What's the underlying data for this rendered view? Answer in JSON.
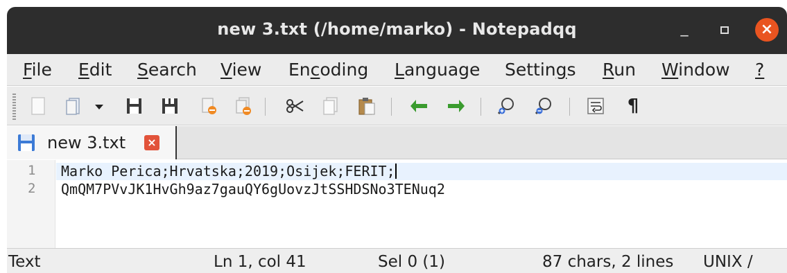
{
  "window": {
    "title": "new 3.txt (/home/marko) - Notepadqq",
    "minimize_glyph": "_",
    "close_glyph": "×"
  },
  "menu": {
    "items": [
      {
        "pre": "",
        "mnemonic": "F",
        "post": "ile"
      },
      {
        "pre": "",
        "mnemonic": "E",
        "post": "dit"
      },
      {
        "pre": "",
        "mnemonic": "S",
        "post": "earch"
      },
      {
        "pre": "",
        "mnemonic": "V",
        "post": "iew"
      },
      {
        "pre": "En",
        "mnemonic": "c",
        "post": "oding"
      },
      {
        "pre": "",
        "mnemonic": "L",
        "post": "anguage"
      },
      {
        "pre": "Settin",
        "mnemonic": "g",
        "post": "s"
      },
      {
        "pre": "",
        "mnemonic": "R",
        "post": "un"
      },
      {
        "pre": "",
        "mnemonic": "W",
        "post": "indow"
      },
      {
        "pre": "",
        "mnemonic": "?",
        "post": ""
      }
    ]
  },
  "toolbar": {
    "icons": [
      "new-file-icon",
      "open-file-icon",
      "open-dropdown-icon",
      "save-icon",
      "save-all-icon",
      "close-icon",
      "close-all-icon",
      "cut-icon",
      "copy-icon",
      "paste-icon",
      "undo-icon",
      "redo-icon",
      "zoom-in-icon",
      "zoom-out-icon",
      "word-wrap-icon",
      "show-all-characters-icon"
    ],
    "pilcrow": "¶"
  },
  "tabs": [
    {
      "label": "new 3.txt",
      "close_glyph": "×"
    }
  ],
  "editor": {
    "lines": [
      {
        "number": "1",
        "text": "Marko Perica;Hrvatska;2019;Osijek;FERIT;"
      },
      {
        "number": "2",
        "text": "QmQM7PVvJK1HvGh9az7gauQY6gUovzJtSSHDSNo3TENuq2"
      }
    ]
  },
  "status": {
    "language": "Text",
    "position": "Ln 1, col 41",
    "selection": "Sel 0 (1)",
    "counts": "87 chars, 2 lines",
    "eol": "UNIX /"
  },
  "colors": {
    "titlebar": "#2d2d2d",
    "close_button": "#e95420",
    "current_line": "#e8f2fe",
    "arrow_green": "#3a9b2e"
  }
}
